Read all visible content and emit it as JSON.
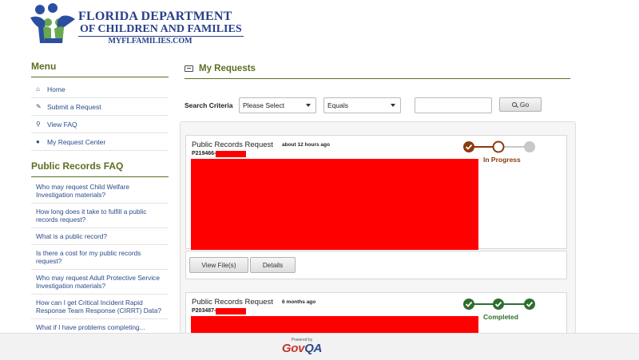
{
  "header": {
    "logo_line1": "FLORIDA DEPARTMENT",
    "logo_line2": "OF CHILDREN AND FAMILIES",
    "logo_line3": "MYFLFAMILIES.COM"
  },
  "sidebar": {
    "menu_heading": "Menu",
    "menu_items": [
      {
        "label": "Home",
        "icon": "home-icon"
      },
      {
        "label": "Submit a Request",
        "icon": "edit-icon"
      },
      {
        "label": "View FAQ",
        "icon": "search-icon"
      },
      {
        "label": "My Request Center",
        "icon": "user-icon"
      }
    ],
    "faq_heading": "Public Records FAQ",
    "faq_items": [
      "Who may request Child Welfare Investigation materials?",
      "How long does it take to fulfill a public records request?",
      "What is a public record?",
      "Is there a cost for my public records request?",
      "Who may request Adult Protective Service Investigation materials?",
      "How can I get Critical Incident Rapid Response Team Response (CIRRT) Data?",
      "What if I have problems completing..."
    ]
  },
  "main": {
    "heading": "My Requests",
    "search": {
      "label": "Search Criteria",
      "field_select": "Please Select",
      "operator_select": "Equals",
      "value": "",
      "go_label": "Go"
    },
    "requests": [
      {
        "title": "Public Records Request",
        "time": "about 12 hours ago",
        "id_prefix": "P219466-",
        "status": "In Progress",
        "steps_complete": 1,
        "steps_current": 2,
        "steps_total": 3,
        "view_files_label": "View File(s)",
        "details_label": "Details"
      },
      {
        "title": "Public Records Request",
        "time": "6 months ago",
        "id_prefix": "P203487-",
        "status": "Completed",
        "steps_complete": 3,
        "steps_total": 3
      }
    ]
  },
  "footer": {
    "powered_by": "Powered by",
    "brand_gov": "Gov",
    "brand_qa": "QA"
  },
  "colors": {
    "accent_green": "#5b6f22",
    "link_blue": "#2a4a8a",
    "progress_brown": "#8b3a10",
    "complete_green": "#2f6e2f",
    "redaction_red": "#ff0000"
  }
}
